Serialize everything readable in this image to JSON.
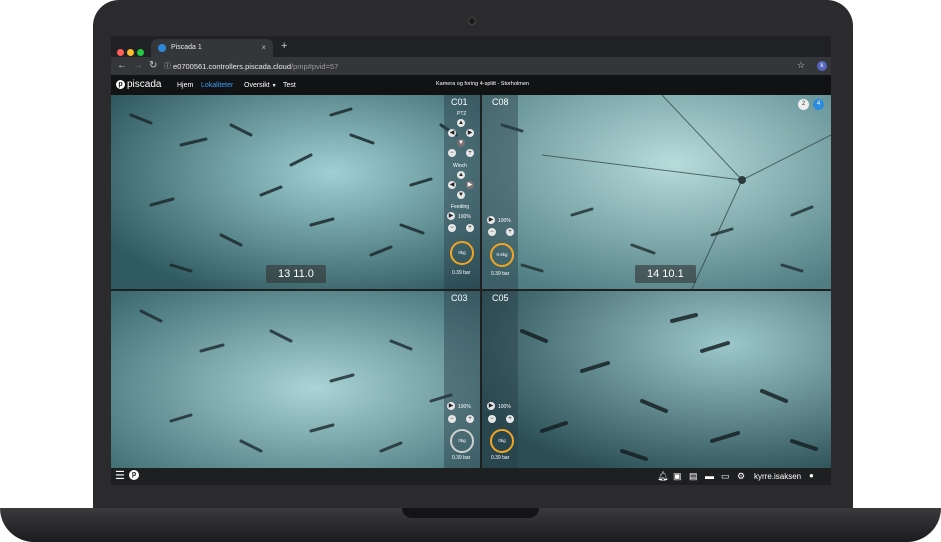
{
  "browser": {
    "tab_title": "Piscada 1",
    "tab_close": "×",
    "new_tab": "+",
    "url_host": "e0700561.controllers.piscada.cloud",
    "url_path": "/pmp#pvid=57",
    "profile_initial": "k"
  },
  "app": {
    "logo_text": "piscada",
    "nav": [
      {
        "label": "Hjem"
      },
      {
        "label": "Lokaliteter"
      },
      {
        "label": "Oversikt"
      },
      {
        "label": "Test"
      }
    ],
    "page_title": "Kamera og foring 4-splitt - Storholmen",
    "badges": [
      "2",
      "4"
    ]
  },
  "cameras": [
    {
      "id": "C01",
      "reading": "13 11.0",
      "ptz": "PTZ",
      "winch": "Winch",
      "feeding": "Feeding",
      "percent": "100%",
      "gauge": "0kg",
      "pressure": "0.39 bar"
    },
    {
      "id": "C08",
      "reading": "14 10.1",
      "percent": "100%",
      "gauge": "0.6kg",
      "pressure": "0.39 bar"
    },
    {
      "id": "C03",
      "percent": "100%",
      "gauge": "0kg",
      "pressure": "0.39 bar"
    },
    {
      "id": "C05",
      "percent": "100%",
      "gauge": "0kg",
      "pressure": "0.39 bar"
    }
  ],
  "statusbar": {
    "username": "kyrre.isaksen"
  },
  "colors": {
    "accent": "#3aa0ff",
    "gauge_active": "#f2a520",
    "water": "#5f8f98"
  }
}
